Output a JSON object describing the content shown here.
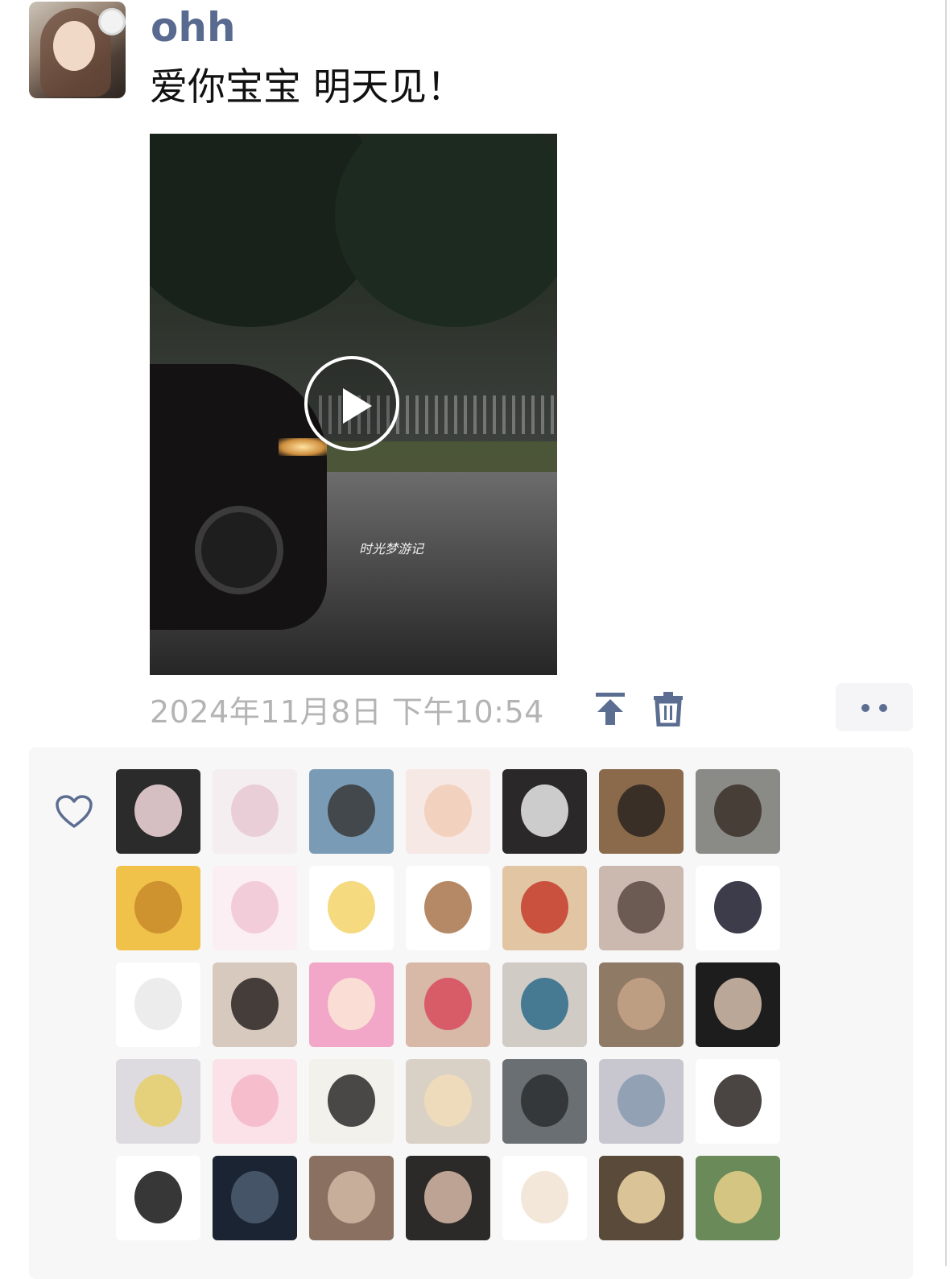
{
  "post": {
    "username": "ohh",
    "text": "爱你宝宝 明天见！",
    "video_watermark": "时光梦游记",
    "timestamp": "2024年11月8日 下午10:54"
  },
  "icons": {
    "pin": "pin-to-top-icon",
    "delete": "trash-icon",
    "more": "more-dots-icon",
    "like": "heart-icon",
    "play": "play-icon"
  },
  "colors": {
    "username": "#586a8f",
    "icon_accent": "#5b6d91",
    "timestamp": "#b4b4b4",
    "likes_bg": "#f7f7f7"
  },
  "likes_avatars": [
    [
      "#2b2b2b",
      "#f3d9dd"
    ],
    [
      "#f4eef0",
      "#e8c8d2"
    ],
    [
      "#7a9bb5",
      "#3a3a3a"
    ],
    [
      "#f6e8e4",
      "#f2cdb8"
    ],
    [
      "#2a2828",
      "#e9e9e9"
    ],
    [
      "#8a6a4a",
      "#2b2420"
    ],
    [
      "#8a8a86",
      "#3b302a"
    ],
    [
      "#f1c24a",
      "#c8892a"
    ],
    [
      "#fbeff3",
      "#f1c6d3"
    ],
    [
      "#ffffff",
      "#f3d36a"
    ],
    [
      "#ffffff",
      "#a8744a"
    ],
    [
      "#e2c5a2",
      "#c43c2c"
    ],
    [
      "#cbb9b0",
      "#5a4a42"
    ],
    [
      "#ffffff",
      "#1a1a2a"
    ],
    [
      "#ffffff",
      "#e9e9e9"
    ],
    [
      "#d8c9bf",
      "#2a2422"
    ],
    [
      "#f2a7c8",
      "#fbe6d6"
    ],
    [
      "#d8b9a8",
      "#d84b5c"
    ],
    [
      "#d1cbc6",
      "#2e6c8a"
    ],
    [
      "#8f7a66",
      "#c7a588"
    ],
    [
      "#1d1d1d",
      "#d6c0ae"
    ],
    [
      "#dedbe0",
      "#e6cf6a"
    ],
    [
      "#fbe1e8",
      "#f4b7c8"
    ],
    [
      "#f3f1ec",
      "#2a2a2a"
    ],
    [
      "#d9d0c6",
      "#f0ddb8"
    ],
    [
      "#6a6f73",
      "#2c2f31"
    ],
    [
      "#c8c6cf",
      "#8a9ab0"
    ],
    [
      "#ffffff",
      "#2a2322"
    ],
    [
      "#ffffff",
      "#141414"
    ],
    [
      "#1a2433",
      "#4d5d70"
    ],
    [
      "#8a7060",
      "#d0b8a4"
    ],
    [
      "#2c2a29",
      "#d6b8a6"
    ],
    [
      "#ffffff",
      "#f1e3d2"
    ],
    [
      "#5a4a3a",
      "#f0d8a8"
    ],
    [
      "#6a8a5a",
      "#e6d08a"
    ]
  ]
}
